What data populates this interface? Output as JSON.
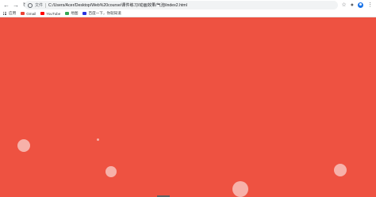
{
  "browser": {
    "security_label": "文件",
    "url": "C:/Users/Acer/Desktop/Web%20course/课件练习/动画效果/气泡/index2.html"
  },
  "bookmarks": [
    {
      "label": "应用",
      "icon": "apps-icon"
    },
    {
      "label": "Gmail",
      "icon": "gmail-icon"
    },
    {
      "label": "YouTube",
      "icon": "youtube-icon"
    },
    {
      "label": "地图",
      "icon": "maps-icon"
    },
    {
      "label": "百度一下，你就知道",
      "icon": "baidu-icon"
    }
  ],
  "page": {
    "background_color": "#ee5241",
    "bubble_color": "#ffffff"
  }
}
